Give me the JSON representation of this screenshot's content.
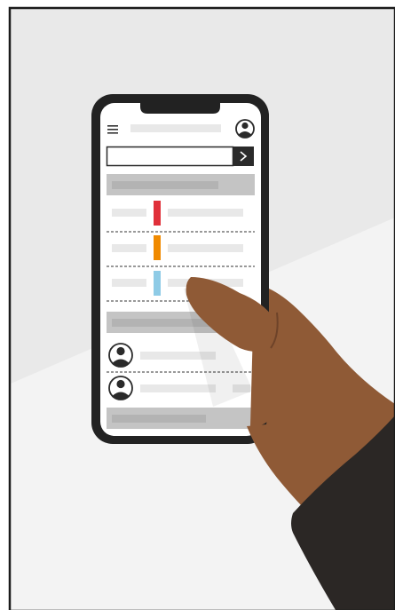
{
  "illustration": {
    "subject": "hand-holding-smartphone",
    "colors": {
      "frame": "#1b1b1b",
      "background_upper": "#e9e9e9",
      "background_lower": "#f3f3f3",
      "phone_body": "#222222",
      "screen": "#ffffff",
      "placeholder_light": "#e8e8e8",
      "placeholder_mid": "#c4c4c4",
      "placeholder_dark": "#b3b3b3",
      "skin": "#8f5a36",
      "skin_shadow": "#6e4329",
      "sleeve": "#2b2725"
    }
  },
  "phone_ui": {
    "menu_icon": "hamburger-menu-icon",
    "profile_icon": "user-avatar-icon",
    "search_submit_icon": "chevron-right-icon",
    "status_items": [
      {
        "color_name": "red",
        "color": "#e0303a"
      },
      {
        "color_name": "orange",
        "color": "#f08a00"
      },
      {
        "color_name": "light-blue",
        "color": "#8ecbe6"
      }
    ],
    "contacts": [
      {
        "avatar_icon": "person-avatar-icon"
      },
      {
        "avatar_icon": "person-avatar-icon"
      }
    ]
  }
}
